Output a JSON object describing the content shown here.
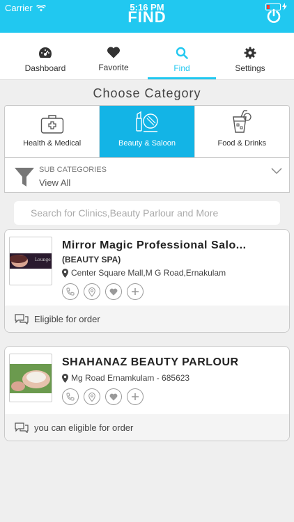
{
  "status": {
    "carrier": "Carrier",
    "time": "5:16 PM"
  },
  "header": {
    "title": "FIND"
  },
  "tabs": [
    {
      "label": "Dashboard",
      "icon": "dashboard-icon"
    },
    {
      "label": "Favorite",
      "icon": "heart-icon"
    },
    {
      "label": "Find",
      "icon": "search-icon",
      "active": true
    },
    {
      "label": "Settings",
      "icon": "gear-icon"
    }
  ],
  "choose_title": "Choose Category",
  "categories": [
    {
      "label": "Health & Medical",
      "icon": "medical-kit-icon"
    },
    {
      "label": "Beauty & Saloon",
      "icon": "beauty-icon",
      "active": true
    },
    {
      "label": "Food & Drinks",
      "icon": "drink-icon"
    }
  ],
  "subcategory": {
    "title": "SUB CATEGORIES",
    "value": "View All"
  },
  "search": {
    "placeholder": "Search for Clinics,Beauty Parlour and More"
  },
  "listings": [
    {
      "name": "Mirror Magic Professional Salo...",
      "subtitle": "(BEAUTY SPA)",
      "address": "Center Square Mall,M G Road,Ernakulam",
      "footer": "Eligible for order"
    },
    {
      "name": "SHAHANAZ BEAUTY PARLOUR",
      "subtitle": "",
      "address": "Mg Road Ernamkulam - 685623",
      "footer": "you can eligible for order"
    }
  ],
  "colors": {
    "accent": "#21c8f0",
    "active_category": "#13b4e6"
  }
}
